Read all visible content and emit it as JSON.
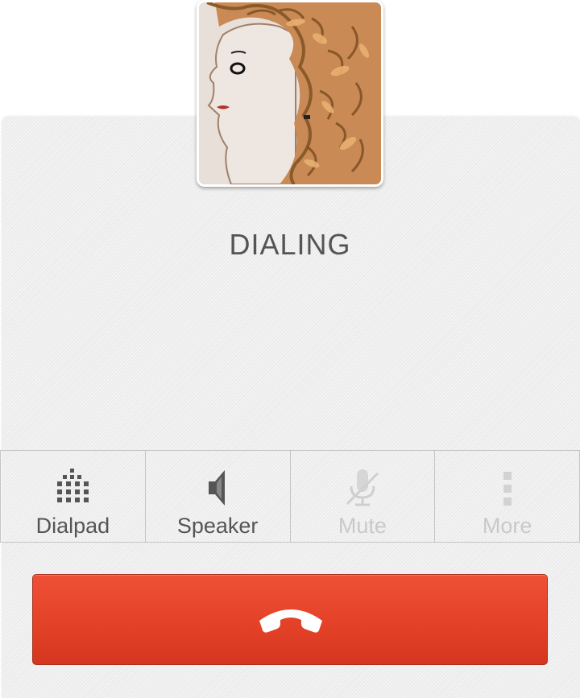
{
  "call": {
    "status": "DIALING"
  },
  "avatar": {
    "icon": "contact-photo"
  },
  "toolbar": {
    "buttons": [
      {
        "label": "Dialpad",
        "icon": "dialpad-icon",
        "enabled": true
      },
      {
        "label": "Speaker",
        "icon": "speaker-icon",
        "enabled": true
      },
      {
        "label": "Mute",
        "icon": "mute-icon",
        "enabled": false
      },
      {
        "label": "More",
        "icon": "more-icon",
        "enabled": false
      }
    ]
  },
  "end_call": {
    "icon": "end-call-icon",
    "color": "#e44228"
  },
  "colors": {
    "text": "#555555",
    "disabled_text": "#c9c9c9",
    "background": "#efefef"
  }
}
